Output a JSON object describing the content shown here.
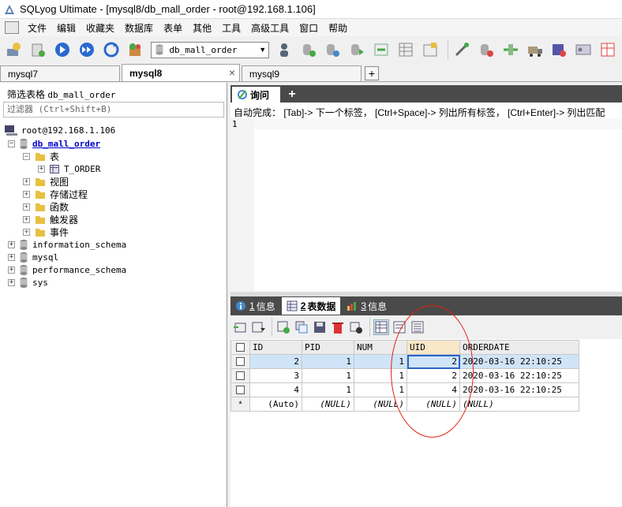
{
  "window": {
    "title": "SQLyog Ultimate - [mysql8/db_mall_order - root@192.168.1.106]"
  },
  "menu": [
    "文件",
    "编辑",
    "收藏夹",
    "数据库",
    "表单",
    "其他",
    "工具",
    "高级工具",
    "窗口",
    "帮助"
  ],
  "toolbar": {
    "database_select": "db_mall_order"
  },
  "connection_tabs": [
    "mysql7",
    "mysql8",
    "mysql9"
  ],
  "left_panel": {
    "filter_label": "筛选表格",
    "filter_db": "db_mall_order",
    "filter_placeholder": "过滤器 (Ctrl+Shift+B)",
    "tree": {
      "connection": "root@192.168.1.106",
      "selected_db": "db_mall_order",
      "folders": {
        "tables": "表",
        "views": "视图",
        "procedures": "存储过程",
        "functions": "函数",
        "triggers": "触发器",
        "events": "事件"
      },
      "table": "T_ORDER",
      "other_dbs": [
        "information_schema",
        "mysql",
        "performance_schema",
        "sys"
      ]
    }
  },
  "query": {
    "tab_label": "询问",
    "autocomplete_hint": "自动完成： [Tab]-> 下一个标签， [Ctrl+Space]-> 列出所有标签， [Ctrl+Enter]-> 列出匹配",
    "line_number": "1"
  },
  "result_tabs": [
    {
      "num": "1",
      "label": "信息"
    },
    {
      "num": "2",
      "label": "表数据"
    },
    {
      "num": "3",
      "label": "信息"
    }
  ],
  "grid": {
    "columns": [
      "ID",
      "PID",
      "NUM",
      "UID",
      "ORDERDATE"
    ],
    "rows": [
      [
        "2",
        "1",
        "1",
        "2",
        "2020-03-16 22:10:25"
      ],
      [
        "3",
        "1",
        "1",
        "2",
        "2020-03-16 22:10:25"
      ],
      [
        "4",
        "1",
        "1",
        "4",
        "2020-03-16 22:10:25"
      ]
    ],
    "new_row": {
      "marker": "*",
      "id": "(Auto)",
      "null": "(NULL)"
    }
  },
  "colors": {
    "accent_dark": "#4a4a4a",
    "selection": "#d0e4f8",
    "annotation": "#dd2211"
  }
}
